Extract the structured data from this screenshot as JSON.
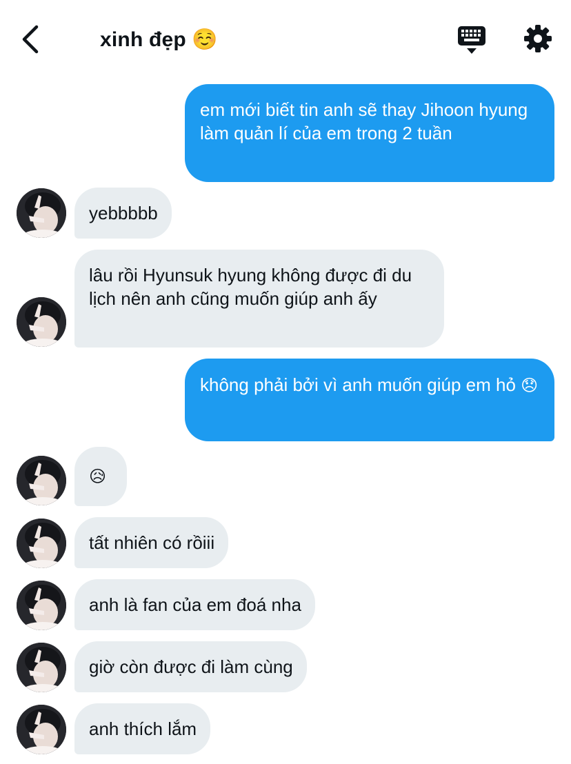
{
  "header": {
    "title": "xinh đẹp",
    "title_emoji": "☺️",
    "back_icon": "chevron-left-icon",
    "keyboard_icon": "keyboard-icon",
    "settings_icon": "gear-icon"
  },
  "colors": {
    "outgoing_bubble": "#1d9bf0",
    "incoming_bubble": "#e8edf0",
    "text": "#0f1419"
  },
  "messages": [
    {
      "sender": "me",
      "text": "em mới biết tin anh sẽ thay Jihoon hyung làm quản lí của em trong 2 tuần"
    },
    {
      "sender": "other",
      "text": "yebbbbb"
    },
    {
      "sender": "other",
      "text": "lâu rồi Hyunsuk hyung không được đi du lịch nên anh cũng muốn giúp anh ấy"
    },
    {
      "sender": "me",
      "text": "không phải bởi vì anh muốn giúp em hỏ",
      "emoji": "😞"
    },
    {
      "sender": "other",
      "text": "",
      "emoji": "😥"
    },
    {
      "sender": "other",
      "text": "tất nhiên có rồiii"
    },
    {
      "sender": "other",
      "text": "anh là fan của em đoá nha"
    },
    {
      "sender": "other",
      "text": "giờ còn được đi làm cùng"
    },
    {
      "sender": "other",
      "text": "anh thích lắm"
    }
  ]
}
